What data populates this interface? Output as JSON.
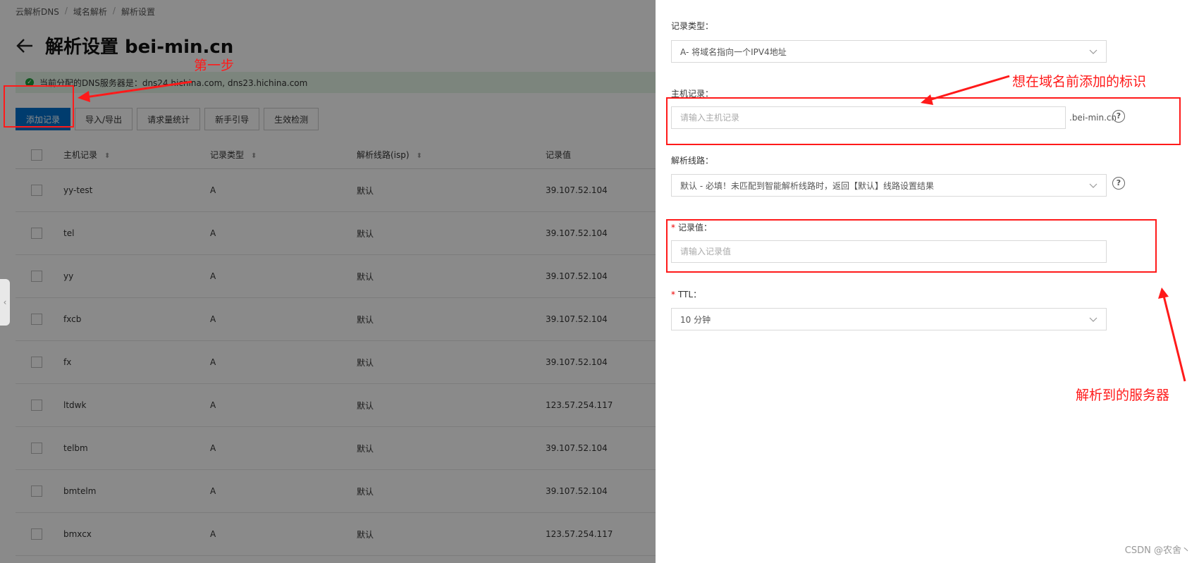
{
  "breadcrumb": [
    "云解析DNS",
    "域名解析",
    "解析设置"
  ],
  "page": {
    "title": "解析设置 bei-min.cn"
  },
  "dns_bar": {
    "text": "当前分配的DNS服务器是：dns24.hichina.com, dns23.hichina.com"
  },
  "toolbar": {
    "add": "添加记录",
    "import_export": "导入/导出",
    "stats": "请求量统计",
    "guide": "新手引导",
    "check": "生效检测"
  },
  "table": {
    "headers": [
      "主机记录",
      "记录类型",
      "解析线路(isp)",
      "记录值"
    ],
    "rows": [
      {
        "host": "yy-test",
        "type": "A",
        "line": "默认",
        "value": "39.107.52.104"
      },
      {
        "host": "tel",
        "type": "A",
        "line": "默认",
        "value": "39.107.52.104"
      },
      {
        "host": "yy",
        "type": "A",
        "line": "默认",
        "value": "39.107.52.104"
      },
      {
        "host": "fxcb",
        "type": "A",
        "line": "默认",
        "value": "39.107.52.104"
      },
      {
        "host": "fx",
        "type": "A",
        "line": "默认",
        "value": "39.107.52.104"
      },
      {
        "host": "ltdwk",
        "type": "A",
        "line": "默认",
        "value": "123.57.254.117"
      },
      {
        "host": "telbm",
        "type": "A",
        "line": "默认",
        "value": "39.107.52.104"
      },
      {
        "host": "bmtelm",
        "type": "A",
        "line": "默认",
        "value": "39.107.52.104"
      },
      {
        "host": "bmxcx",
        "type": "A",
        "line": "默认",
        "value": "123.57.254.117"
      }
    ]
  },
  "form": {
    "record_type": {
      "label": "记录类型：",
      "value": "A- 将域名指向一个IPV4地址"
    },
    "host": {
      "label": "主机记录：",
      "placeholder": "请输入主机记录",
      "suffix": ".bei-min.cn"
    },
    "line": {
      "label": "解析线路：",
      "value": "默认 - 必填！未匹配到智能解析线路时，返回【默认】线路设置结果"
    },
    "record_value": {
      "required_mark": "*",
      "label": "记录值：",
      "placeholder": "请输入记录值"
    },
    "ttl": {
      "required_mark": "*",
      "label": "TTL：",
      "value": "10 分钟"
    },
    "help_glyph": "?"
  },
  "annotations": {
    "step1": "第一步",
    "host_note": "想在域名前添加的标识",
    "value_note": "解析到的服务器"
  },
  "watermark": "CSDN @农舍丶",
  "colors": {
    "primary": "#0070cc",
    "annotation": "#ff1a1a",
    "success": "#1e9e3a"
  }
}
